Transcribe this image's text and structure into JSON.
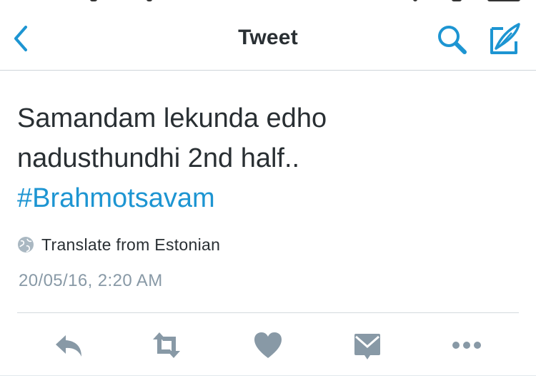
{
  "colors": {
    "accent": "#1d95d2",
    "text": "#292f33",
    "secondary_text": "#8899a6",
    "action_icon": "#8899a6",
    "divider": "#d4dade"
  },
  "navbar": {
    "title": "Tweet",
    "back_icon": "chevron-left-icon",
    "search_icon": "search-icon",
    "compose_icon": "compose-tweet-icon"
  },
  "tweet": {
    "lines": [
      "Samandam lekunda edho",
      "nadusthundhi 2nd half.."
    ],
    "hashtag": "#Brahmotsavam",
    "translate_label": "Translate from Estonian",
    "timestamp": "20/05/16, 2:20 AM"
  },
  "actions": [
    {
      "name": "reply",
      "icon": "reply-icon"
    },
    {
      "name": "retweet",
      "icon": "retweet-icon"
    },
    {
      "name": "like",
      "icon": "heart-icon"
    },
    {
      "name": "direct-message",
      "icon": "envelope-icon"
    },
    {
      "name": "more",
      "icon": "more-icon"
    }
  ]
}
